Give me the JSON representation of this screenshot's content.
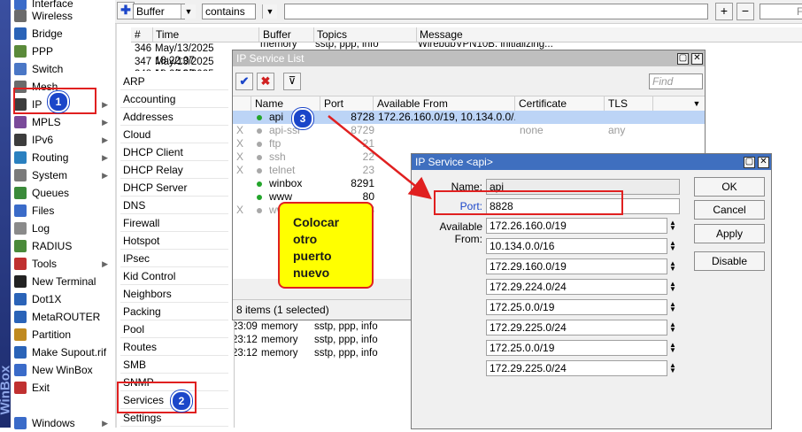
{
  "main_menu": {
    "items": [
      {
        "label": "Interface",
        "icon": "interface-icon",
        "color": "#3a6bc9"
      },
      {
        "label": "Wireless",
        "icon": "wireless-icon",
        "color": "#6b6b6b"
      },
      {
        "label": "Bridge",
        "icon": "bridge-icon",
        "color": "#2a63b8"
      },
      {
        "label": "PPP",
        "icon": "ppp-icon",
        "color": "#5a8a3a"
      },
      {
        "label": "Switch",
        "icon": "switch-icon",
        "color": "#4a77c6"
      },
      {
        "label": "Mesh",
        "icon": "mesh-icon",
        "color": "#6b6b6b"
      },
      {
        "label": "IP",
        "icon": "ip-icon",
        "color": "#3c3c3c"
      },
      {
        "label": "MPLS",
        "icon": "mpls-icon",
        "color": "#7a4a9a"
      },
      {
        "label": "IPv6",
        "icon": "ipv6-icon",
        "color": "#3c3c3c"
      },
      {
        "label": "Routing",
        "icon": "routing-icon",
        "color": "#2a80c0"
      },
      {
        "label": "System",
        "icon": "system-icon",
        "color": "#7a7a7a"
      },
      {
        "label": "Queues",
        "icon": "queues-icon",
        "color": "#3a8a3a"
      },
      {
        "label": "Files",
        "icon": "files-icon",
        "color": "#3a6bc9"
      },
      {
        "label": "Log",
        "icon": "log-icon",
        "color": "#8a8a8a"
      },
      {
        "label": "RADIUS",
        "icon": "radius-icon",
        "color": "#4a8a3a"
      },
      {
        "label": "Tools",
        "icon": "tools-icon",
        "color": "#c03030"
      },
      {
        "label": "New Terminal",
        "icon": "terminal-icon",
        "color": "#222222"
      },
      {
        "label": "Dot1X",
        "icon": "dot1x-icon",
        "color": "#2a63b8"
      },
      {
        "label": "MetaROUTER",
        "icon": "metarouter-icon",
        "color": "#2a63b8"
      },
      {
        "label": "Partition",
        "icon": "partition-icon",
        "color": "#c08a20"
      },
      {
        "label": "Make Supout.rif",
        "icon": "supout-icon",
        "color": "#2a63b8"
      },
      {
        "label": "New WinBox",
        "icon": "winbox-icon",
        "color": "#3a6bc9"
      },
      {
        "label": "Exit",
        "icon": "exit-icon",
        "color": "#c03030"
      },
      {
        "label": "Windows",
        "icon": "windows-icon",
        "color": "#3a6bc9"
      }
    ],
    "brand_text": "WinBox"
  },
  "ip_submenu": {
    "items": [
      "ARP",
      "Accounting",
      "Addresses",
      "Cloud",
      "DHCP Client",
      "DHCP Relay",
      "DHCP Server",
      "DNS",
      "Firewall",
      "Hotspot",
      "IPsec",
      "Kid Control",
      "Neighbors",
      "Packing",
      "Pool",
      "Routes",
      "SMB",
      "SNMP",
      "Services",
      "Settings"
    ]
  },
  "log_window": {
    "filter_field": "Buffer",
    "filter_op": "contains",
    "filter_value": "",
    "find_label": "Fi",
    "columns": [
      "#",
      "Time",
      "Buffer",
      "Topics",
      "Message"
    ],
    "rows": [
      {
        "num": "346",
        "time": "May/13/2025 18:22:07",
        "buffer": "memory",
        "topics": "sstp, ppp, info",
        "message": "WirebubVPN10B: initializing..."
      },
      {
        "num": "347",
        "time": "May/13/2025 18:22:07",
        "buffer": "memory",
        "topics": "sstp, ppp, info",
        "message": ""
      },
      {
        "num": "348",
        "time": "May/13/2025 18:22:07",
        "buffer": "memory",
        "topics": "sstp, ppp, info",
        "message": ""
      }
    ],
    "bottom_rows": [
      {
        "time": "23:09",
        "buffer": "memory",
        "topics": "sstp, ppp, info"
      },
      {
        "time": "23:12",
        "buffer": "memory",
        "topics": "sstp, ppp, info"
      },
      {
        "time": "23:12",
        "buffer": "memory",
        "topics": "sstp, ppp, info"
      }
    ]
  },
  "service_list": {
    "title": "IP Service List",
    "find_placeholder": "Find",
    "columns": [
      "Name",
      "Port",
      "Available From",
      "Certificate",
      "TLS Ver..."
    ],
    "rows": [
      {
        "flag": "",
        "name": "api",
        "port": "8728",
        "available": "172.26.160.0/19, 10.134.0.0/...",
        "cert": "",
        "tls": "",
        "enabled": true,
        "selected": true
      },
      {
        "flag": "X",
        "name": "api-ssl",
        "port": "8729",
        "available": "",
        "cert": "none",
        "tls": "any",
        "enabled": false,
        "selected": false
      },
      {
        "flag": "X",
        "name": "ftp",
        "port": "21",
        "available": "",
        "cert": "",
        "tls": "",
        "enabled": false,
        "selected": false
      },
      {
        "flag": "X",
        "name": "ssh",
        "port": "22",
        "available": "",
        "cert": "",
        "tls": "",
        "enabled": false,
        "selected": false
      },
      {
        "flag": "X",
        "name": "telnet",
        "port": "23",
        "available": "",
        "cert": "",
        "tls": "",
        "enabled": false,
        "selected": false
      },
      {
        "flag": "",
        "name": "winbox",
        "port": "8291",
        "available": "",
        "cert": "",
        "tls": "",
        "enabled": true,
        "selected": false
      },
      {
        "flag": "",
        "name": "www",
        "port": "80",
        "available": "",
        "cert": "",
        "tls": "",
        "enabled": true,
        "selected": false
      },
      {
        "flag": "X",
        "name": "www-ssl",
        "port": "443",
        "available": "",
        "cert": "",
        "tls": "",
        "enabled": false,
        "selected": false
      }
    ],
    "status": "8 items (1 selected)"
  },
  "service_detail": {
    "title": "IP Service <api>",
    "name_label": "Name:",
    "name_value": "api",
    "port_label": "Port:",
    "port_value": "8828",
    "available_label": "Available From:",
    "available_from": [
      "172.26.160.0/19",
      "10.134.0.0/16",
      "172.29.160.0/19",
      "172.29.224.0/24",
      "172.25.0.0/19",
      "172.29.225.0/24",
      "172.25.0.0/19",
      "172.29.225.0/24"
    ],
    "buttons": {
      "ok": "OK",
      "cancel": "Cancel",
      "apply": "Apply",
      "disable": "Disable"
    }
  },
  "annotations": {
    "badges": [
      "1",
      "2",
      "3"
    ],
    "note": [
      "Colocar",
      "otro",
      "puerto",
      "nuevo"
    ],
    "accent_red": "#e02020",
    "badge_blue": "#1b46c9",
    "note_yellow": "#ffff00"
  }
}
